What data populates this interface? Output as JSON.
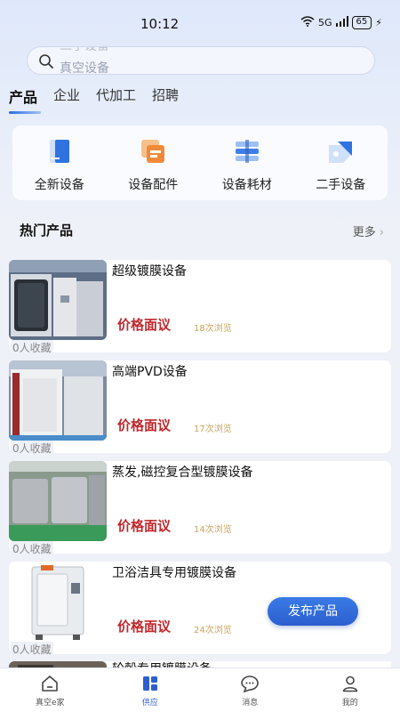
{
  "status": {
    "time": "10:12",
    "signal": "5G",
    "battery": "65"
  },
  "search": {
    "placeholder": "真空设备",
    "ghost": "二手设备"
  },
  "tabs": [
    {
      "label": "产品"
    },
    {
      "label": "企业"
    },
    {
      "label": "代加工"
    },
    {
      "label": "招聘"
    }
  ],
  "categories": [
    {
      "label": "全新设备",
      "icon": "new-device-icon"
    },
    {
      "label": "设备配件",
      "icon": "accessory-icon"
    },
    {
      "label": "设备耗材",
      "icon": "consumable-icon"
    },
    {
      "label": "二手设备",
      "icon": "second-hand-icon"
    }
  ],
  "section": {
    "title": "热门产品",
    "more": "更多"
  },
  "products": [
    {
      "title": "超级镀膜设备",
      "price": "价格面议",
      "views": "18次浏览",
      "fav": "0人收藏"
    },
    {
      "title": "高端PVD设备",
      "price": "价格面议",
      "views": "17次浏览",
      "fav": "0人收藏"
    },
    {
      "title": "蒸发,磁控复合型镀膜设备",
      "price": "价格面议",
      "views": "14次浏览",
      "fav": "0人收藏"
    },
    {
      "title": "卫浴洁具专用镀膜设备",
      "price": "价格面议",
      "views": "24次浏览",
      "fav": "0人收藏"
    }
  ],
  "partial_product": {
    "title": "轮毂专用镀膜设备"
  },
  "publish_button": "发布产品",
  "tabbar": [
    {
      "label": "真空e家",
      "icon": "home-icon"
    },
    {
      "label": "供应",
      "icon": "supply-icon"
    },
    {
      "label": "消息",
      "icon": "message-icon"
    },
    {
      "label": "我的",
      "icon": "profile-icon"
    }
  ],
  "colors": {
    "accent": "#2d5fcf",
    "price": "#c1272d",
    "views": "#c8a462"
  }
}
